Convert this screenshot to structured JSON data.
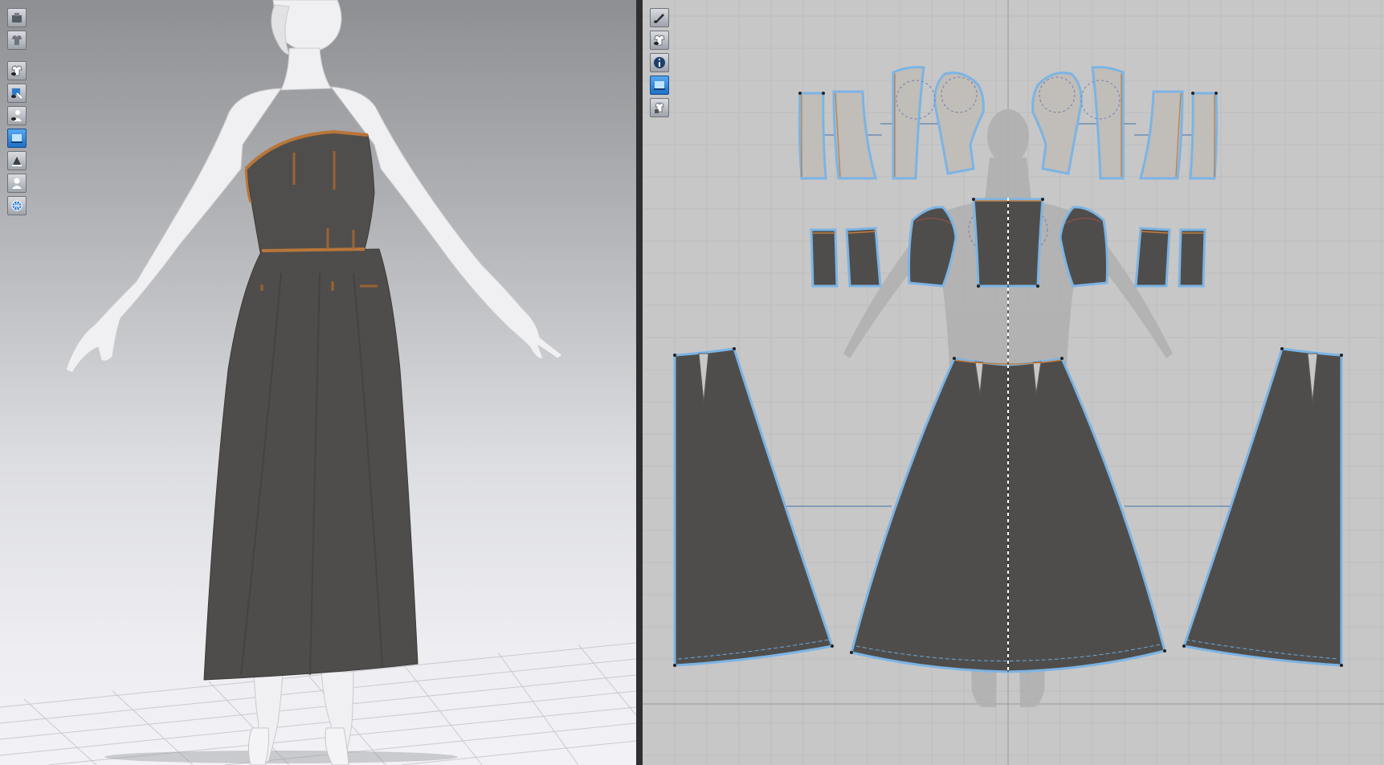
{
  "app": {
    "view_3d": {
      "toolbar": [
        {
          "icon": "avatar-display-icon",
          "active": false
        },
        {
          "icon": "garment-display-icon",
          "active": false
        },
        {
          "icon": "show-garment-icon",
          "active": false
        },
        {
          "icon": "show-pins-icon",
          "active": false
        },
        {
          "icon": "show-avatar-icon",
          "active": false
        },
        {
          "icon": "texture-surface-icon",
          "active": true
        },
        {
          "icon": "render-mode-icon",
          "active": false
        },
        {
          "icon": "avatar-silhouette-icon",
          "active": false
        },
        {
          "icon": "mesh-globe-icon",
          "active": false
        }
      ]
    },
    "view_2d": {
      "toolbar": [
        {
          "icon": "pen-tool-icon",
          "active": false
        },
        {
          "icon": "garment-tool-icon",
          "active": false
        },
        {
          "icon": "info-icon",
          "active": false
        },
        {
          "icon": "fabric-texture-icon",
          "active": true
        },
        {
          "icon": "lock-garment-icon",
          "active": false
        }
      ]
    },
    "colors": {
      "garment": "#4f4d4b",
      "upper_piece_fill": "#c1bdb8",
      "pattern_outline": "#7cb4e4",
      "piece_edge_orange": "#c47e3e",
      "grid_line": "#b8b8b8",
      "viewport_bg_2d": "#c7c7c7"
    }
  }
}
